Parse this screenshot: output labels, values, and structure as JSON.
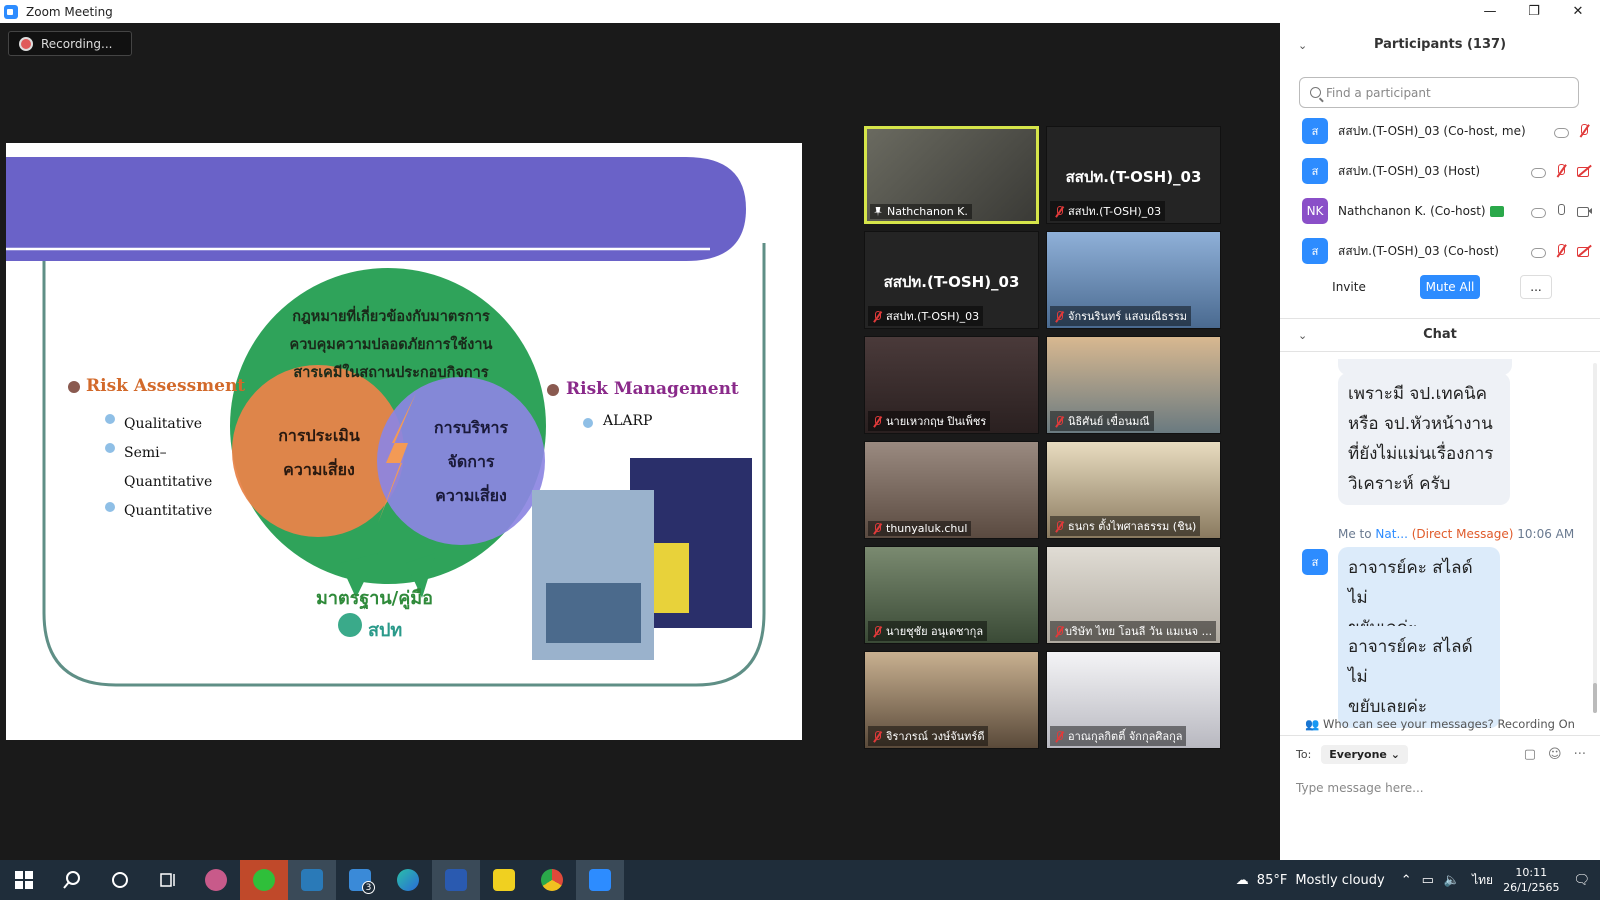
{
  "window": {
    "title": "Zoom Meeting",
    "minimize": "—",
    "restore": "❐",
    "close": "✕"
  },
  "recording": {
    "label": "Recording..."
  },
  "slide": {
    "left_heading": "Risk Assessment",
    "left_items": [
      "Qualitative",
      "Semi–",
      "Quantitative",
      "Quantitative"
    ],
    "right_heading": "Risk Management",
    "right_items": [
      "ALARP"
    ],
    "circle_title_lines": [
      "กฎหมายที่เกี่ยวข้องกับมาตรการ",
      "ควบคุมความปลอดภัยการใช้งาน",
      "สารเคมีในสถานประกอบกิจการ"
    ],
    "assess_lines": [
      "การประเมิน",
      "ความเสี่ยง"
    ],
    "manage_lines": [
      "การบริหาร",
      "จัดการ",
      "ความเสี่ยง"
    ],
    "standard_label": "มาตรฐาน/คู่มือ",
    "logo_text": "สปท"
  },
  "tiles": [
    {
      "name": "Nathchanon K.",
      "big": "",
      "pinned": true,
      "active": true,
      "bg": "#5a5a55"
    },
    {
      "name": "สสปท.(T-OSH)_03",
      "big": "สสปท.(T-OSH)_03",
      "pinned": false,
      "active": false,
      "bg": "#242424"
    },
    {
      "name": "สสปท.(T-OSH)_03",
      "big": "สสปท.(T-OSH)_03",
      "pinned": false,
      "active": false,
      "bg": "#242424"
    },
    {
      "name": "จักรนรินทร์ แสงมณีธรรม",
      "big": "",
      "pinned": false,
      "active": false,
      "bg": "#6f8fb4"
    },
    {
      "name": "นายเหวกฤษ ปินเพ็ชร",
      "big": "",
      "pinned": false,
      "active": false,
      "bg": "#3b3030"
    },
    {
      "name": "นิธิศันย์ เขื่อนมณี",
      "big": "",
      "pinned": false,
      "active": false,
      "bg": "#8d7a68"
    },
    {
      "name": "thunyaluk.chul",
      "big": "",
      "pinned": false,
      "active": false,
      "bg": "#7a6a60"
    },
    {
      "name": "ธนกร ตั้งไพศาลธรรม (ชิน)",
      "big": "",
      "pinned": false,
      "active": false,
      "bg": "#b9a98a"
    },
    {
      "name": "นายชุชัย อนุเดชากุล",
      "big": "",
      "pinned": false,
      "active": false,
      "bg": "#5c6a58"
    },
    {
      "name": "บริษัท ไทย โอนลี วัน แมเนจ ...",
      "big": "",
      "pinned": false,
      "active": false,
      "bg": "#cfcac0"
    },
    {
      "name": "จิราภรณ์ วงษ์จันทร์ดี",
      "big": "",
      "pinned": false,
      "active": false,
      "bg": "#b49a78"
    },
    {
      "name": "อาณกุลกิตติ์ จักกุลศิลกุล",
      "big": "",
      "pinned": false,
      "active": false,
      "bg": "#e6e6ea"
    }
  ],
  "participants": {
    "header": "Participants (137)",
    "search_placeholder": "Find a participant",
    "list": [
      {
        "initial": "ส",
        "name": "สสปท.(T-OSH)_03 (Co-host, me)",
        "mic": "off",
        "cam": "off",
        "share": false,
        "nk": false
      },
      {
        "initial": "ส",
        "name": "สสปท.(T-OSH)_03 (Host)",
        "mic": "off",
        "cam": "off",
        "share": false,
        "nk": false
      },
      {
        "initial": "NK",
        "name": "Nathchanon K. (Co-host)",
        "mic": "on",
        "cam": "on",
        "share": true,
        "nk": true
      },
      {
        "initial": "ส",
        "name": "สสปท.(T-OSH)_03 (Co-host)",
        "mic": "off",
        "cam": "off",
        "share": false,
        "nk": false
      }
    ],
    "invite": "Invite",
    "mute_all": "Mute All",
    "more": "..."
  },
  "chat": {
    "header": "Chat",
    "msg1_lines": [
      "เพราะมี จป.เทคนิค",
      "หรือ จป.หัวหน้างาน",
      "ที่ยังไม่แม่นเรื่องการ",
      "วิเคราะห์ ครับ"
    ],
    "meta_me": "Me to ",
    "meta_to": "Nat...",
    "meta_dm": "(Direct Message)",
    "meta_time": "10:06 AM",
    "avatar_initial": "ส",
    "msg2_lines": [
      "อาจารย์คะ สไลด์ไม่",
      "ขยับเลค่ะ"
    ],
    "msg3_lines": [
      "อาจารย์คะ สไลด์ไม่",
      "ขยับเลยค่ะ"
    ],
    "visibility": "Who can see your messages? Recording On",
    "to_label": "To:",
    "to_value": "Everyone ⌄",
    "placeholder": "Type message here..."
  },
  "taskbar": {
    "weather_temp": "85°F",
    "weather_text": "Mostly cloudy",
    "lang": "ไทย",
    "time": "10:11",
    "date": "26/1/2565",
    "mail_badge": "3",
    "icons": [
      "windows-start",
      "search",
      "cortana",
      "task-view",
      "weather-app",
      "line-app",
      "control-app",
      "mail-app",
      "edge-browser",
      "word-app",
      "sticky-notes",
      "chrome-browser",
      "zoom-app"
    ]
  },
  "colors": {
    "zoom_blue": "#2D8CFF",
    "mute_red": "#e03a3a",
    "active_border": "#d6e54a",
    "slide_purple": "#6a62c8",
    "slide_green": "#2fa35a",
    "slide_orange": "#e8844a"
  }
}
